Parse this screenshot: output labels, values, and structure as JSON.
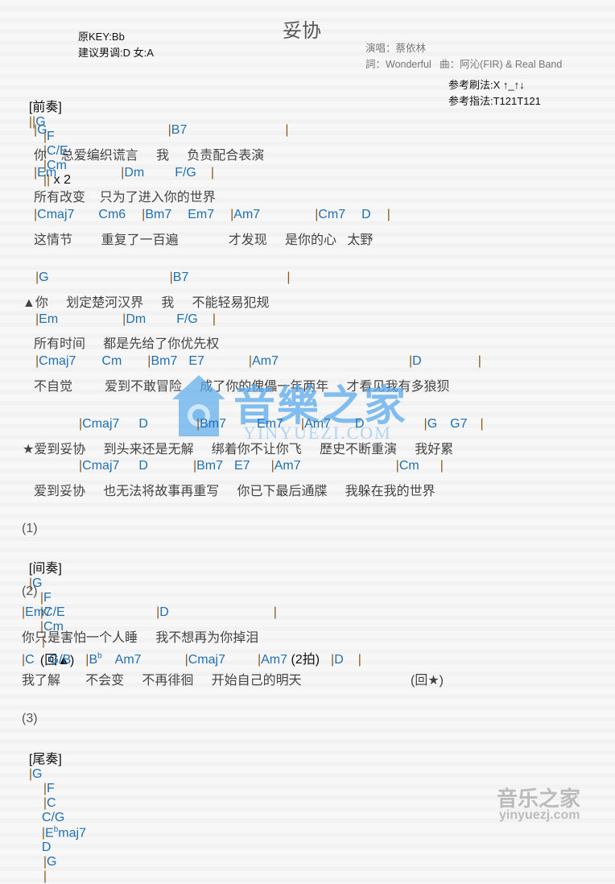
{
  "header": {
    "title": "妥协",
    "original_key": "原KEY:Bb",
    "suggested_key": "建议男调:D 女:A",
    "singer": "演唱：蔡依林",
    "credits": "詞：Wonderful   曲：阿沁(FIR) & Real Band",
    "strum": "参考刷法:X ↑_↑↓",
    "pick": "参考指法:T121T121"
  },
  "intro": {
    "label": "[前奏]",
    "chords": [
      "G",
      "F",
      "C/E",
      "Cm"
    ],
    "repeat": "x 2"
  },
  "verse1": [
    {
      "chords": [
        {
          "t": "G"
        },
        {
          "t": "B7"
        }
      ],
      "lyric": "你    总爱编织谎言     我     负责配合表演"
    },
    {
      "chords": [
        {
          "t": "Em"
        },
        {
          "t": "Dm"
        },
        {
          "t": "F/G"
        }
      ],
      "lyric": "所有改变    只为了进入你的世界"
    },
    {
      "chords": [
        {
          "t": "Cmaj7"
        },
        {
          "t": "Cm6"
        },
        {
          "t": "Bm7"
        },
        {
          "t": "Em7"
        },
        {
          "t": "Am7"
        },
        {
          "t": "Cm7"
        },
        {
          "t": "D"
        }
      ],
      "lyric": "这情节        重复了一百遍              才发现     是你的心   太野"
    }
  ],
  "verse2": [
    {
      "chords": [
        {
          "t": "G"
        },
        {
          "t": "B7"
        }
      ],
      "lyric": "▲你     划定楚河汉界     我     不能轻易犯规"
    },
    {
      "chords": [
        {
          "t": "Em"
        },
        {
          "t": "Dm"
        },
        {
          "t": "F/G"
        }
      ],
      "lyric": "所有时间     都是先给了你优先权"
    },
    {
      "chords": [
        {
          "t": "Cmaj7"
        },
        {
          "t": "Cm"
        },
        {
          "t": "Bm7"
        },
        {
          "t": "E7"
        },
        {
          "t": "Am7"
        },
        {
          "t": "D"
        }
      ],
      "lyric": "不自觉         爱到不敢冒险     成了你的傀儡一年两年     才看见我有多狼狈"
    }
  ],
  "chorus": [
    {
      "chords": [
        {
          "t": "Cmaj7"
        },
        {
          "t": "D"
        },
        {
          "t": "Bm7"
        },
        {
          "t": "Em7"
        },
        {
          "t": "Am7"
        },
        {
          "t": "D"
        },
        {
          "t": "G"
        },
        {
          "t": "G7"
        }
      ],
      "lyric": "★爱到妥协     到头来还是无解     绑着你不让你飞     歷史不断重演     我好累"
    },
    {
      "chords": [
        {
          "t": "Cmaj7"
        },
        {
          "t": "D"
        },
        {
          "t": "Bm7"
        },
        {
          "t": "E7"
        },
        {
          "t": "Am7"
        },
        {
          "t": "Cm"
        }
      ],
      "lyric": "爱到妥协     也无法将故事再重写     你已下最后通牒     我躲在我的世界"
    }
  ],
  "interlude": {
    "section": "(1)",
    "label": "[间奏]",
    "chords": [
      "G",
      "F",
      "C/E",
      "Cm"
    ],
    "return": "(回▲)"
  },
  "bridge": {
    "section": "(2)",
    "line1_chords": [
      "Em7",
      "D"
    ],
    "line1_lyric": "你只是害怕一个人睡     我不想再为你掉泪",
    "line2_chords": [
      "C",
      "G/B",
      "B",
      "b",
      "Am7",
      "Cmaj7",
      "Am7",
      "(2拍)",
      "D"
    ],
    "line2_lyric": "我了解       不会变     不再徘徊     开始自己的明天",
    "return": "(回★)"
  },
  "outro": {
    "section": "(3)",
    "label": "[尾奏]",
    "chords": [
      "G",
      "F",
      "C",
      "C/G",
      "E",
      "b",
      "maj7",
      "D",
      "G"
    ]
  },
  "watermark": {
    "main": "音樂之家",
    "sub": "YINYUEZI.COM"
  },
  "footer_logo": {
    "main": "音乐之家",
    "sub": "yinyuezj.com"
  }
}
